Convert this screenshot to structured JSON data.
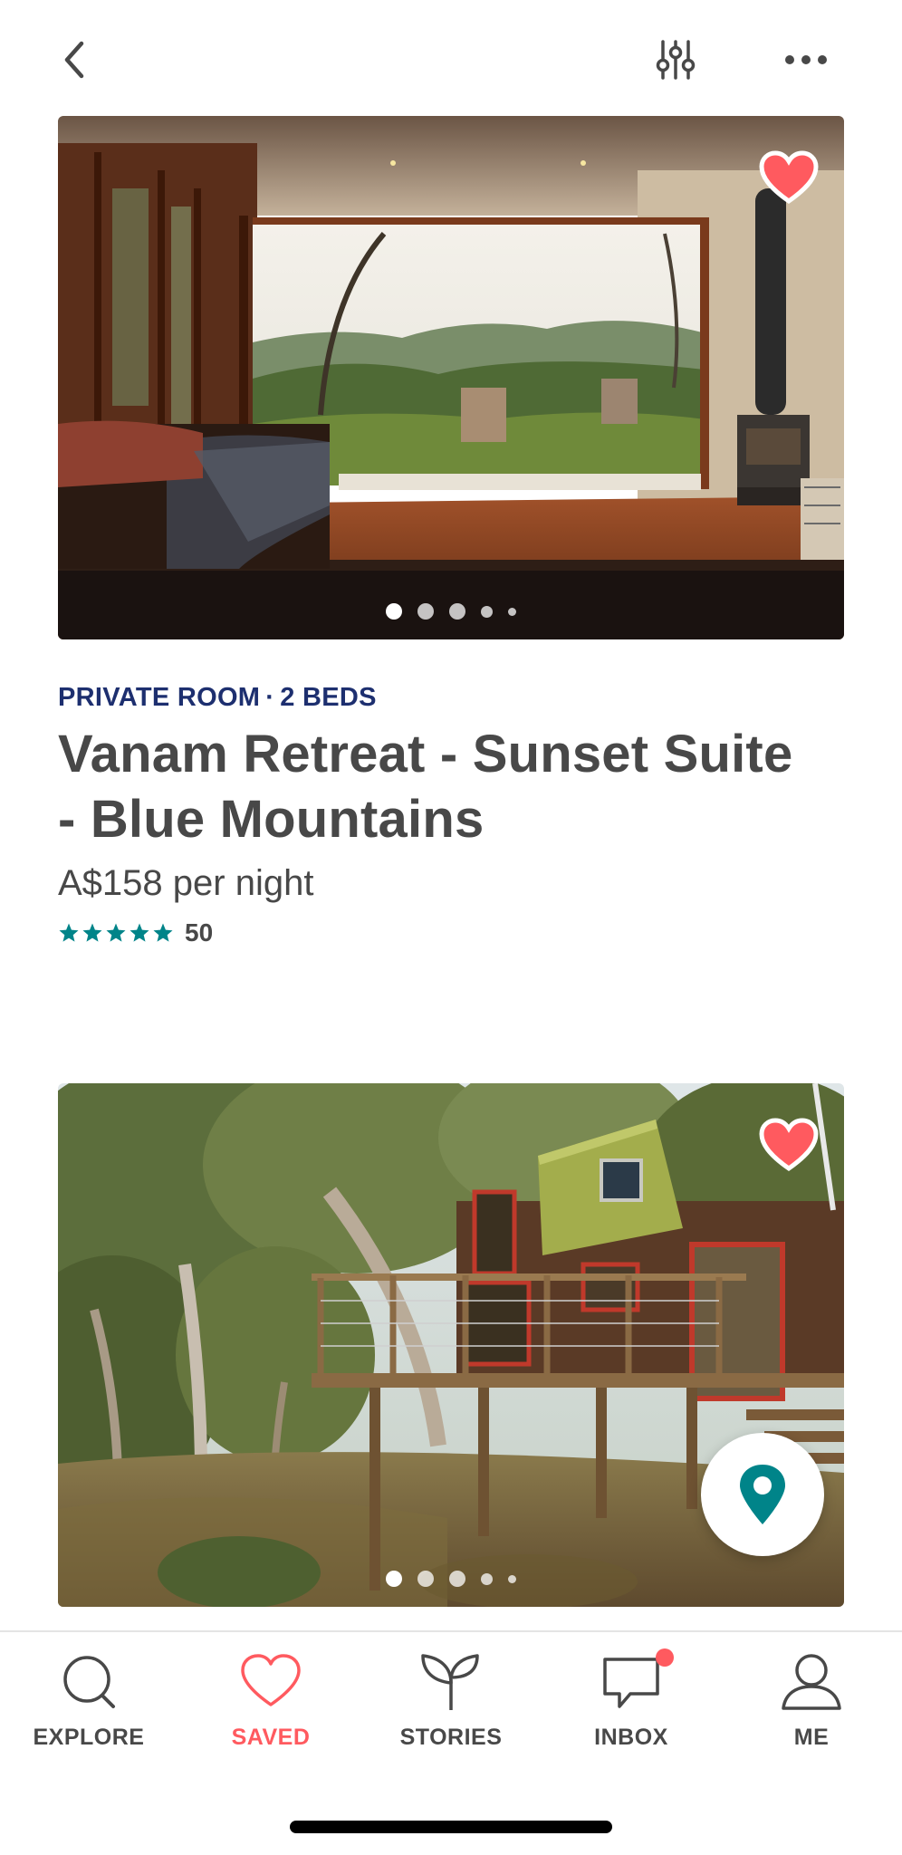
{
  "colors": {
    "brand": "#ff5a5f",
    "teal": "#008489",
    "room_type": "#1d2f6f",
    "text": "#484848"
  },
  "header": {
    "icons": [
      "chevron-left-icon",
      "filter-sliders-icon",
      "more-dots-icon"
    ]
  },
  "listings": [
    {
      "room_type": "PRIVATE ROOM",
      "beds": "2 BEDS",
      "separator": "·",
      "title": "Vanam Retreat - Sunset Suite - Blue Mountains",
      "price": "A$158 per night",
      "rating_stars": 5,
      "review_count": "50",
      "saved": true,
      "photo_index": 1,
      "photo_count": 5
    },
    {
      "saved": true,
      "photo_index": 1,
      "photo_count": 5
    }
  ],
  "bottom_nav": {
    "items": [
      {
        "label": "EXPLORE",
        "icon": "search-icon",
        "active": false
      },
      {
        "label": "SAVED",
        "icon": "heart-icon",
        "active": true
      },
      {
        "label": "STORIES",
        "icon": "sprout-icon",
        "active": false
      },
      {
        "label": "INBOX",
        "icon": "chat-bubble-icon",
        "active": false,
        "badge": true
      },
      {
        "label": "ME",
        "icon": "person-icon",
        "active": false
      }
    ]
  }
}
